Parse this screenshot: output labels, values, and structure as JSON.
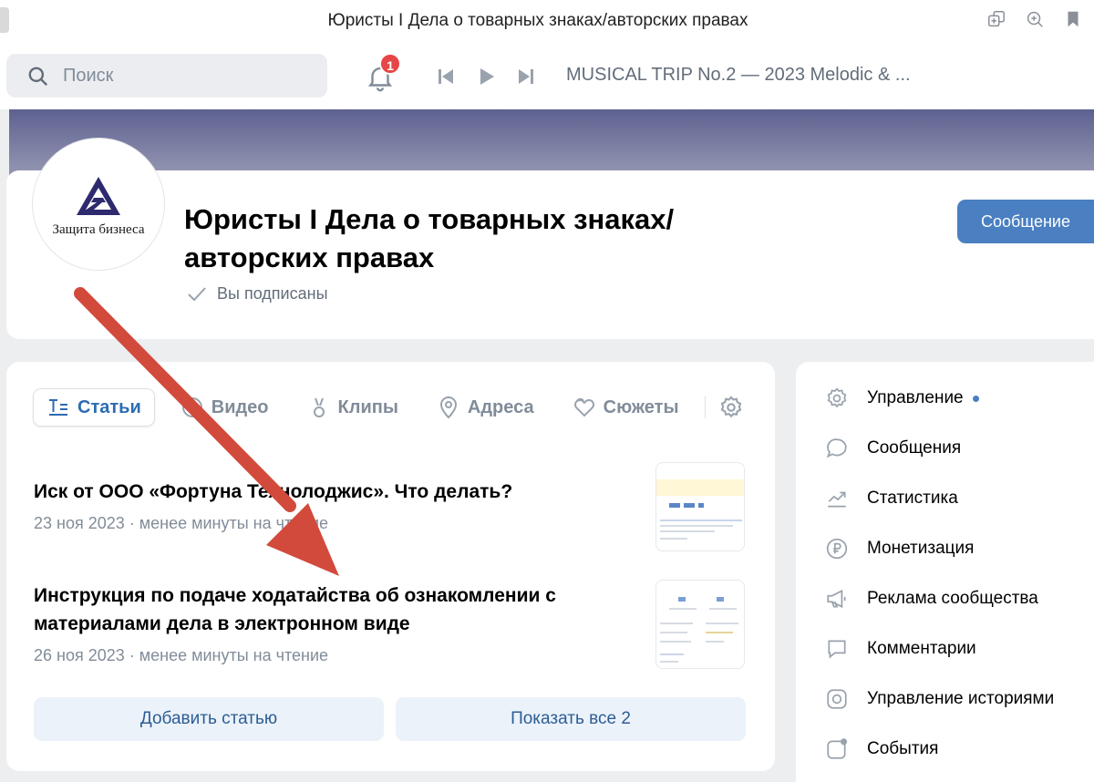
{
  "window": {
    "title": "Юристы I Дела о товарных знаках/авторских правах"
  },
  "topbar": {
    "search_placeholder": "Поиск",
    "notifications_count": "1",
    "now_playing": "MUSICAL TRIP No.2 — 2023 Melodic & ..."
  },
  "group": {
    "avatar_caption": "Защита бизнеса",
    "name": "Юристы I Дела о товарных знаках/ авторских правах",
    "subscription_status": "Вы подписаны",
    "message_button": "Сообщение"
  },
  "tabs": [
    {
      "label": "Статьи"
    },
    {
      "label": "Видео"
    },
    {
      "label": "Клипы"
    },
    {
      "label": "Адреса"
    },
    {
      "label": "Сюжеты"
    }
  ],
  "articles": [
    {
      "title": "Иск от ООО «Фортуна Технолоджис». Что делать?",
      "meta": "23 ноя 2023 · менее минуты на чтение"
    },
    {
      "title": "Инструкция по подаче ходатайства об ознакомлении с материалами дела в электронном виде",
      "meta": "26 ноя 2023 · менее минуты на чтение"
    }
  ],
  "actions": {
    "add_article": "Добавить статью",
    "show_all": "Показать все 2"
  },
  "sidebar": {
    "items": [
      {
        "label": "Управление"
      },
      {
        "label": "Сообщения"
      },
      {
        "label": "Статистика"
      },
      {
        "label": "Монетизация"
      },
      {
        "label": "Реклама сообщества"
      },
      {
        "label": "Комментарии"
      },
      {
        "label": "Управление историями"
      },
      {
        "label": "События"
      }
    ]
  },
  "colors": {
    "accent": "#4a7fc1",
    "annotation_arrow": "#d24a3c"
  }
}
